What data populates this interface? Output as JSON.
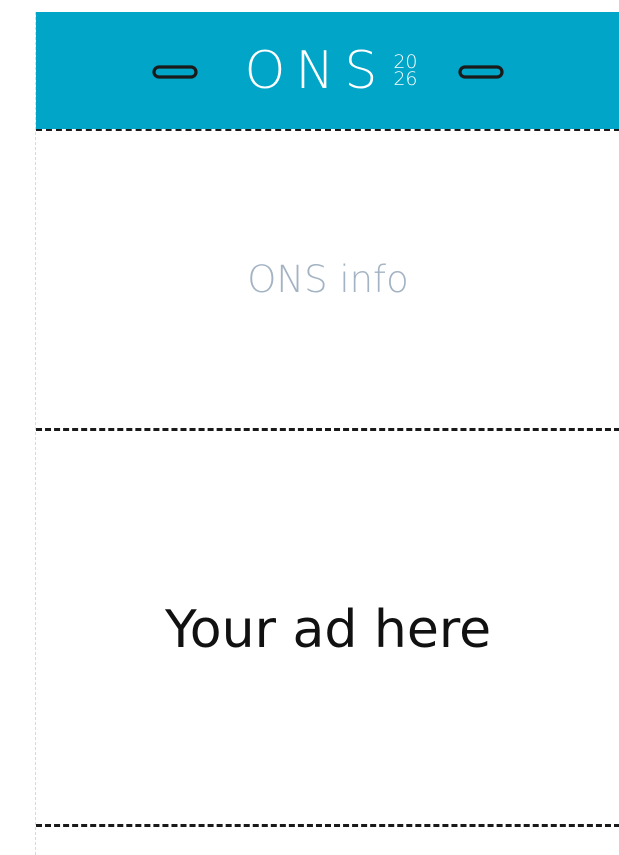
{
  "colors": {
    "header_bg": "#00a5c7",
    "info_text": "#a3b3c3",
    "ad_text": "#111111"
  },
  "header": {
    "logo_text": "ONS",
    "year_top": "20",
    "year_bottom": "26",
    "left_icon": "badge-slot-icon",
    "right_icon": "badge-slot-icon"
  },
  "info": {
    "label": "ONS info"
  },
  "ad": {
    "label": "Your ad here"
  }
}
